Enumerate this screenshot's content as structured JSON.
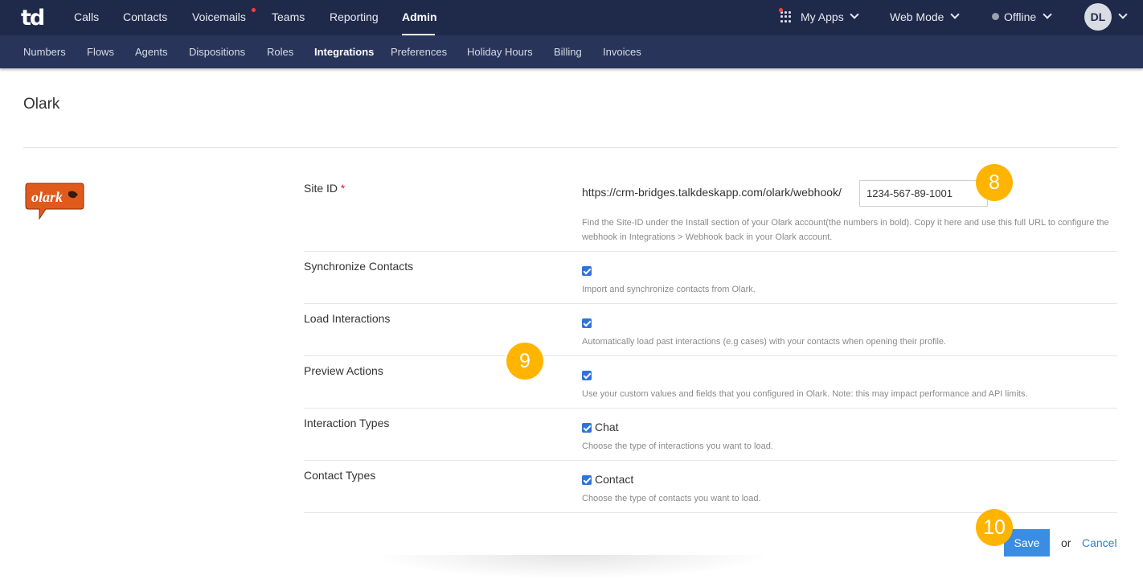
{
  "app": {
    "logo_text": "td"
  },
  "top_nav": {
    "items": [
      "Calls",
      "Contacts",
      "Voicemails",
      "Teams",
      "Reporting",
      "Admin"
    ],
    "active": "Admin",
    "my_apps": "My Apps",
    "mode": "Web Mode",
    "status": "Offline",
    "avatar_initials": "DL"
  },
  "sub_nav": {
    "items": [
      "Numbers",
      "Flows",
      "Agents",
      "Dispositions",
      "Roles",
      "Integrations",
      "Preferences",
      "Holiday Hours",
      "Billing",
      "Invoices"
    ],
    "active": "Integrations"
  },
  "page": {
    "title": "Olark",
    "logo_text": "olark"
  },
  "form": {
    "site_id": {
      "label": "Site ID",
      "required_mark": "*",
      "url_prefix": "https://crm-bridges.talkdeskapp.com/olark/webhook/",
      "value": "1234-567-89-1001",
      "help_line1": "Find the Site-ID under the Install section of your Olark account(the numbers in bold). Copy it here and use this full URL to configure the",
      "help_line2": "webhook in Integrations > Webhook back in your Olark account."
    },
    "sync_contacts": {
      "label": "Synchronize Contacts",
      "checked": true,
      "help": "Import and synchronize contacts from Olark."
    },
    "load_interactions": {
      "label": "Load Interactions",
      "checked": true,
      "help": "Automatically load past interactions (e.g cases) with your contacts when opening their profile."
    },
    "preview_actions": {
      "label": "Preview Actions",
      "checked": true,
      "help": "Use your custom values and fields that you configured in Olark. Note: this may impact performance and API limits."
    },
    "interaction_types": {
      "label": "Interaction Types",
      "option": "Chat",
      "checked": true,
      "help": "Choose the type of interactions you want to load."
    },
    "contact_types": {
      "label": "Contact Types",
      "option": "Contact",
      "checked": true,
      "help": "Choose the type of contacts you want to load."
    }
  },
  "actions": {
    "save": "Save",
    "or": "or",
    "cancel": "Cancel"
  },
  "markers": [
    "8",
    "9",
    "10"
  ],
  "colors": {
    "topbar": "#1f2a4a",
    "subbar": "#29345a",
    "checkbox": "#2f74d8",
    "save": "#3a8de3",
    "marker": "#ffb400",
    "olark": "#e05a1c"
  }
}
